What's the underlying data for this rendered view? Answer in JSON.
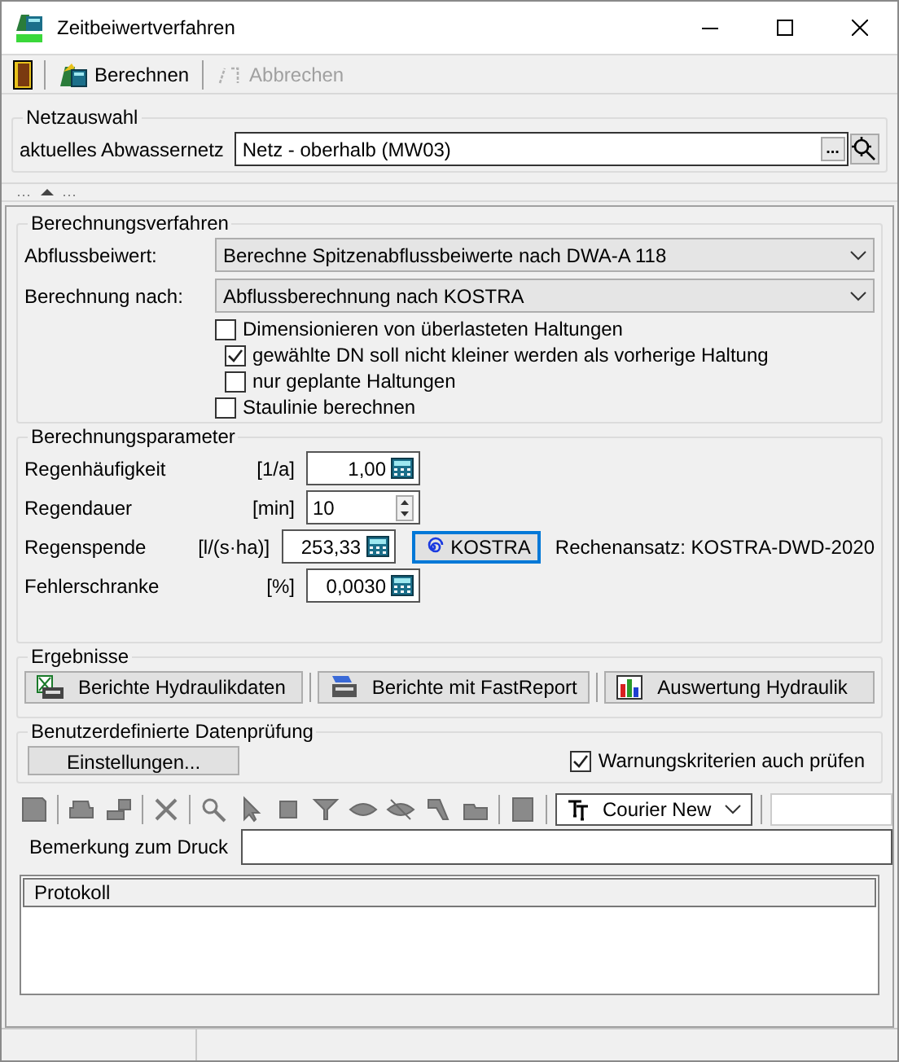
{
  "window": {
    "title": "Zeitbeiwertverfahren"
  },
  "toolbar": [
    {
      "kind": "exit",
      "disabled": false
    },
    {
      "kind": "button",
      "label": "Berechnen",
      "disabled": false
    },
    {
      "kind": "button",
      "label": "Abbrechen",
      "disabled": true
    }
  ],
  "netzauswahl": {
    "title": "Netzauswahl",
    "label": "aktuelles Abwassernetz",
    "value": "Netz - oberhalb (MW03)",
    "browse": "..."
  },
  "berechnungsverfahren": {
    "title": "Berechnungsverfahren",
    "selects": [
      {
        "label": "Abflussbeiwert:",
        "value": "Berechne Spitzenabflussbeiwerte nach DWA-A 118"
      },
      {
        "label": "Berechnung nach:",
        "value": "Abflussberechnung nach KOSTRA"
      }
    ],
    "options": [
      {
        "label": "Dimensionieren von überlasteten Haltungen",
        "checked": false,
        "children": [
          {
            "label": "gewählte DN soll nicht kleiner werden als vorherige Haltung",
            "checked": true
          },
          {
            "label": "nur geplante Haltungen",
            "checked": false
          }
        ]
      },
      {
        "label": "Staulinie berechnen",
        "checked": false
      }
    ]
  },
  "berechnungsparameter": {
    "title": "Berechnungsparameter",
    "rows": [
      {
        "label": "Regenhäufigkeit",
        "unit": "[1/a]",
        "value": "1,00",
        "kind": "calc"
      },
      {
        "label": "Regendauer",
        "unit": "[min]",
        "value": "10",
        "kind": "spin"
      },
      {
        "label": "Regenspende",
        "unit": "[l/(s·ha)]",
        "value": "253,33",
        "kind": "calc",
        "button": "KOSTRA",
        "note": "Rechenansatz: KOSTRA-DWD-2020"
      },
      {
        "label": "Fehlerschranke",
        "unit": "[%]",
        "value": "0,0030",
        "kind": "calc"
      }
    ]
  },
  "ergebnisse": {
    "title": "Ergebnisse",
    "buttons": [
      {
        "label": "Berichte Hydraulikdaten",
        "kind": "hydraulik"
      },
      {
        "label": "Berichte mit FastReport",
        "kind": "fastreport"
      },
      {
        "label": "Auswertung Hydraulik",
        "kind": "auswertung"
      }
    ]
  },
  "datenpruefung": {
    "title": "Benutzerdefinierte Datenprüfung",
    "button": "Einstellungen...",
    "check": {
      "label": "Warnungskriterien auch prüfen",
      "checked": true
    }
  },
  "print_toolbar": {
    "font": "Courier New"
  },
  "bemerkung": {
    "label": "Bemerkung zum Druck"
  },
  "protokoll": {
    "header": "Protokoll"
  }
}
